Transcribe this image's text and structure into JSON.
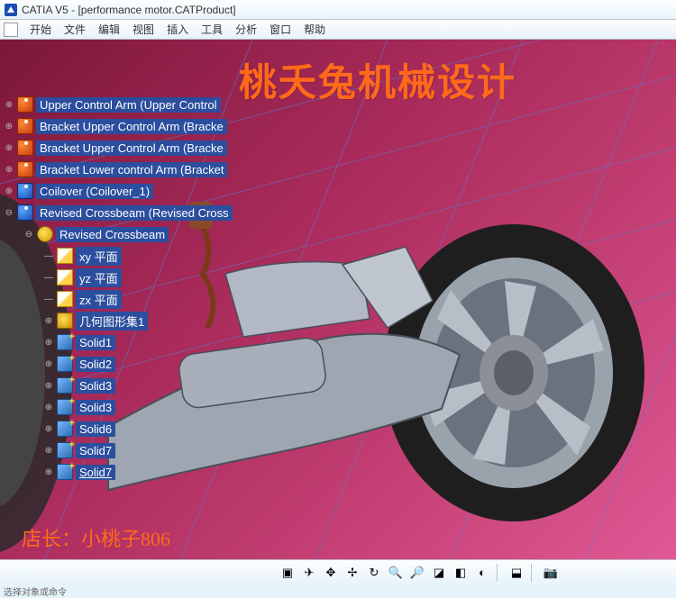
{
  "titlebar": {
    "title": "CATIA V5 - [performance motor.CATProduct]"
  },
  "menubar": {
    "items": [
      "开始",
      "文件",
      "编辑",
      "视图",
      "插入",
      "工具",
      "分析",
      "窗口",
      "帮助"
    ]
  },
  "watermark": {
    "title": "桃夭兔机械设计",
    "author": "店长：小桃子806"
  },
  "tree": {
    "items": [
      {
        "depth": 0,
        "expand": "⊕",
        "icon": "part",
        "label": "Upper Control Arm (Upper Control"
      },
      {
        "depth": 0,
        "expand": "⊕",
        "icon": "part",
        "label": "Bracket Upper Control Arm (Bracke"
      },
      {
        "depth": 0,
        "expand": "⊕",
        "icon": "part",
        "label": "Bracket Upper Control Arm (Bracke"
      },
      {
        "depth": 0,
        "expand": "⊕",
        "icon": "part",
        "label": "Bracket Lower control Arm (Bracket"
      },
      {
        "depth": 0,
        "expand": "⊕",
        "icon": "part-blue",
        "label": "Coilover (Coilover_1)"
      },
      {
        "depth": 0,
        "expand": "⊖",
        "icon": "part-blue",
        "label": "Revised Crossbeam (Revised Cross"
      },
      {
        "depth": 1,
        "expand": "⊖",
        "icon": "gear",
        "label": "Revised Crossbeam"
      },
      {
        "depth": 2,
        "expand": "—",
        "icon": "plane",
        "label": "xy 平面"
      },
      {
        "depth": 2,
        "expand": "—",
        "icon": "plane",
        "label": "yz 平面"
      },
      {
        "depth": 2,
        "expand": "—",
        "icon": "plane",
        "label": "zx 平面"
      },
      {
        "depth": 2,
        "expand": "⊕",
        "icon": "geom",
        "label": "几何图形集1"
      },
      {
        "depth": 2,
        "expand": "⊕",
        "icon": "solid",
        "label": "Solid1"
      },
      {
        "depth": 2,
        "expand": "⊕",
        "icon": "solid",
        "label": "Solid2"
      },
      {
        "depth": 2,
        "expand": "⊕",
        "icon": "solid",
        "label": "Solid3"
      },
      {
        "depth": 2,
        "expand": "⊕",
        "icon": "solid",
        "label": "Solid3"
      },
      {
        "depth": 2,
        "expand": "⊕",
        "icon": "solid",
        "label": "Solid6"
      },
      {
        "depth": 2,
        "expand": "⊕",
        "icon": "solid",
        "label": "Solid7"
      },
      {
        "depth": 2,
        "expand": "⊕",
        "icon": "solid",
        "label": "Solid7",
        "underline": true
      }
    ]
  },
  "toolbar": {
    "buttons": [
      {
        "name": "expand-all-icon",
        "glyph": "▣"
      },
      {
        "name": "fly-icon",
        "glyph": "✈"
      },
      {
        "name": "fit-all-icon",
        "glyph": "✥"
      },
      {
        "name": "pan-icon",
        "glyph": "✢"
      },
      {
        "name": "rotate-icon",
        "glyph": "↻"
      },
      {
        "name": "zoom-in-icon",
        "glyph": "🔍"
      },
      {
        "name": "zoom-out-icon",
        "glyph": "🔎"
      },
      {
        "name": "normal-view-icon",
        "glyph": "◪"
      },
      {
        "name": "iso-view-icon",
        "glyph": "◧"
      },
      {
        "name": "shading-icon",
        "glyph": "◐"
      },
      {
        "name": "sep",
        "glyph": ""
      },
      {
        "name": "hide-show-icon",
        "glyph": "⬓"
      },
      {
        "name": "sep",
        "glyph": ""
      },
      {
        "name": "camera-icon",
        "glyph": "📷"
      }
    ]
  },
  "statusbar": {
    "text": "选择对象或命令"
  }
}
